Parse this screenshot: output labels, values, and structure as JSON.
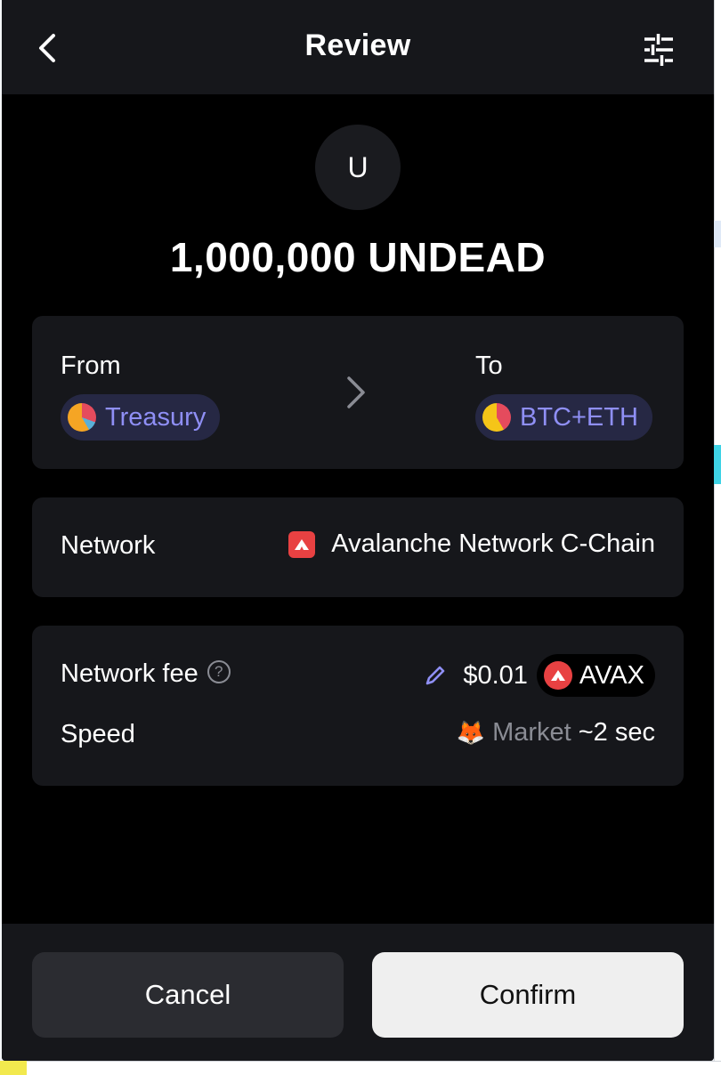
{
  "header": {
    "title": "Review",
    "back_icon": "chevron-left-icon",
    "settings_icon": "sliders-icon"
  },
  "token": {
    "avatar_letter": "U",
    "amount": "1,000,000 UNDEAD"
  },
  "transfer": {
    "from_label": "From",
    "from_account": "Treasury",
    "to_label": "To",
    "to_account": "BTC+ETH"
  },
  "network": {
    "label": "Network",
    "value": "Avalanche Network C-Chain"
  },
  "fee": {
    "label": "Network fee",
    "help_icon_text": "?",
    "amount": "$0.01",
    "token": "AVAX",
    "speed_label": "Speed",
    "speed_emoji": "🦊",
    "speed_mode": "Market",
    "speed_time": "~2 sec"
  },
  "footer": {
    "cancel_label": "Cancel",
    "confirm_label": "Confirm"
  },
  "colors": {
    "accent": "#8f8ff5",
    "avax_red": "#e84142",
    "card_bg": "#16171b"
  }
}
